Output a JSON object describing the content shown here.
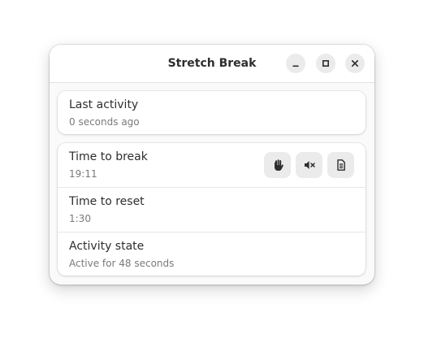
{
  "window": {
    "title": "Stretch Break",
    "controls": {
      "minimize": "minimize-icon",
      "maximize": "maximize-icon",
      "close": "close-icon"
    }
  },
  "last_activity": {
    "label": "Last activity",
    "value": "0 seconds ago"
  },
  "status": {
    "rows": [
      {
        "label": "Time to break",
        "value": "19:11",
        "actions": [
          {
            "name": "take-break",
            "icon": "hand-icon"
          },
          {
            "name": "mute",
            "icon": "speaker-muted-icon"
          },
          {
            "name": "log",
            "icon": "document-icon"
          }
        ]
      },
      {
        "label": "Time to reset",
        "value": "1:30"
      },
      {
        "label": "Activity state",
        "value": "Active for 48 seconds"
      }
    ]
  },
  "colors": {
    "window_bg": "#fafafa",
    "card_bg": "#ffffff",
    "button_bg": "#ebebeb",
    "text_primary": "#2e2e2e",
    "text_secondary": "#7a7a7a"
  }
}
